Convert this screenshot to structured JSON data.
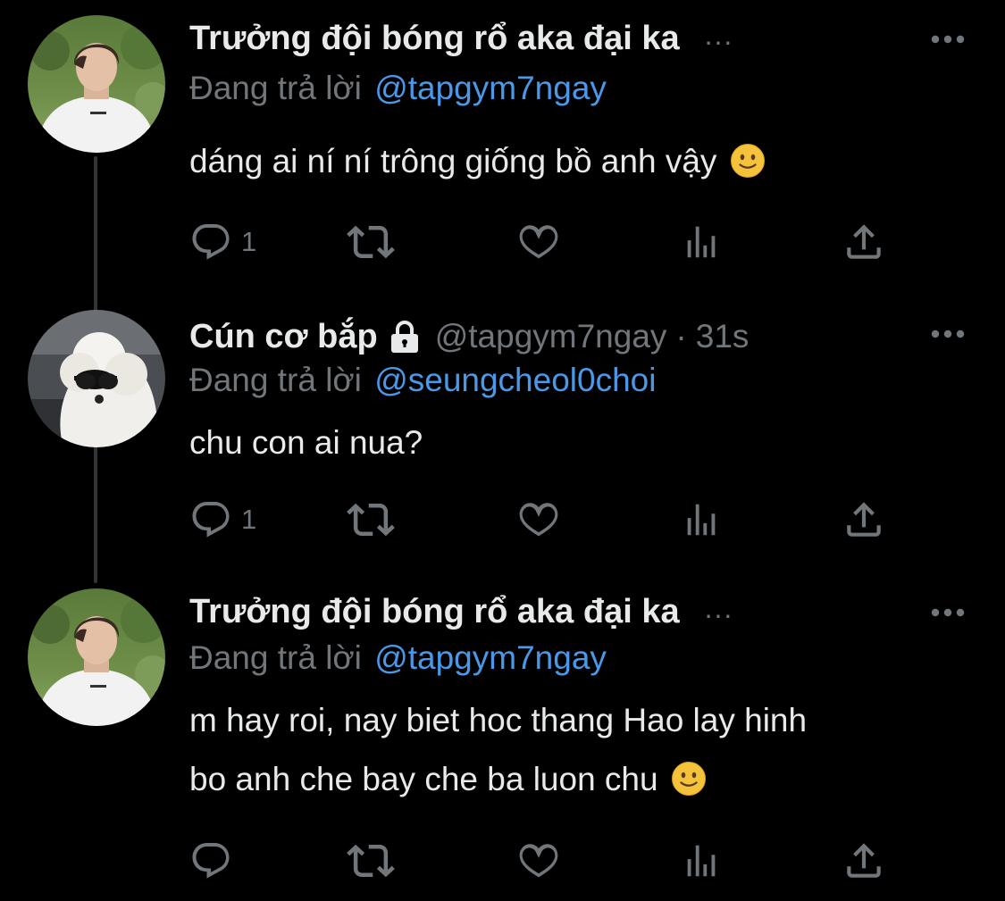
{
  "colors": {
    "background": "#000000",
    "text_primary": "#e7e9ea",
    "text_secondary": "#71767b",
    "mention": "#4a99e9",
    "thread_line": "#333639"
  },
  "reply_prefix": "Đang trả lời",
  "tweets": [
    {
      "display_name": "Trưởng đội bóng rổ aka đại ka",
      "name_truncation": "...",
      "reply_to": "@tapgym7ngay",
      "text": "dáng ai ní ní trông giống bồ anh vậy",
      "emoji": "slightly-smiling-face",
      "reply_count": "1",
      "avatar": "avatar-person-white-tshirt"
    },
    {
      "display_name": "Cún cơ bắp",
      "handle": "@tapgym7ngay",
      "separator": "·",
      "timestamp": "31s",
      "protected": true,
      "reply_to": "@seungcheol0choi",
      "text": "chu con ai nua?",
      "reply_count": "1",
      "avatar": "avatar-white-dog-sunglasses"
    },
    {
      "display_name": "Trưởng đội bóng rổ aka đại ka",
      "name_truncation": "...",
      "reply_to": "@tapgym7ngay",
      "text_line1": "m hay roi, nay biet hoc thang Hao lay hinh",
      "text_line2": "bo anh che bay che ba luon chu",
      "emoji": "slightly-smiling-face",
      "reply_count": "",
      "avatar": "avatar-person-white-tshirt"
    }
  ],
  "icons": [
    "reply-icon",
    "retweet-icon",
    "like-icon",
    "analytics-icon",
    "share-icon",
    "more-icon",
    "lock-icon"
  ]
}
